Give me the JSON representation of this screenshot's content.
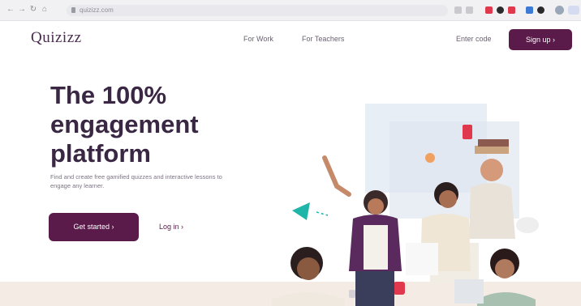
{
  "browser": {
    "url": "quizizz.com",
    "icons": [
      "back-icon",
      "forward-icon",
      "reload-icon",
      "home-icon"
    ]
  },
  "header": {
    "logo": "Quizizz",
    "nav": [
      "For Work",
      "For Teachers"
    ],
    "enter_code": "Enter code",
    "signup": "Sign up ›"
  },
  "hero": {
    "title": "The 100% engagement platform",
    "subtitle": "Find and create free gamified quizzes and interactive lessons to engage any learner.",
    "cta_primary": "Get started ›",
    "cta_secondary": "Log in ›"
  },
  "colors": {
    "brand": "#5a1a4a",
    "heading": "#3a2744",
    "accent_red": "#e0384c",
    "accent_teal": "#1fb5a8"
  }
}
